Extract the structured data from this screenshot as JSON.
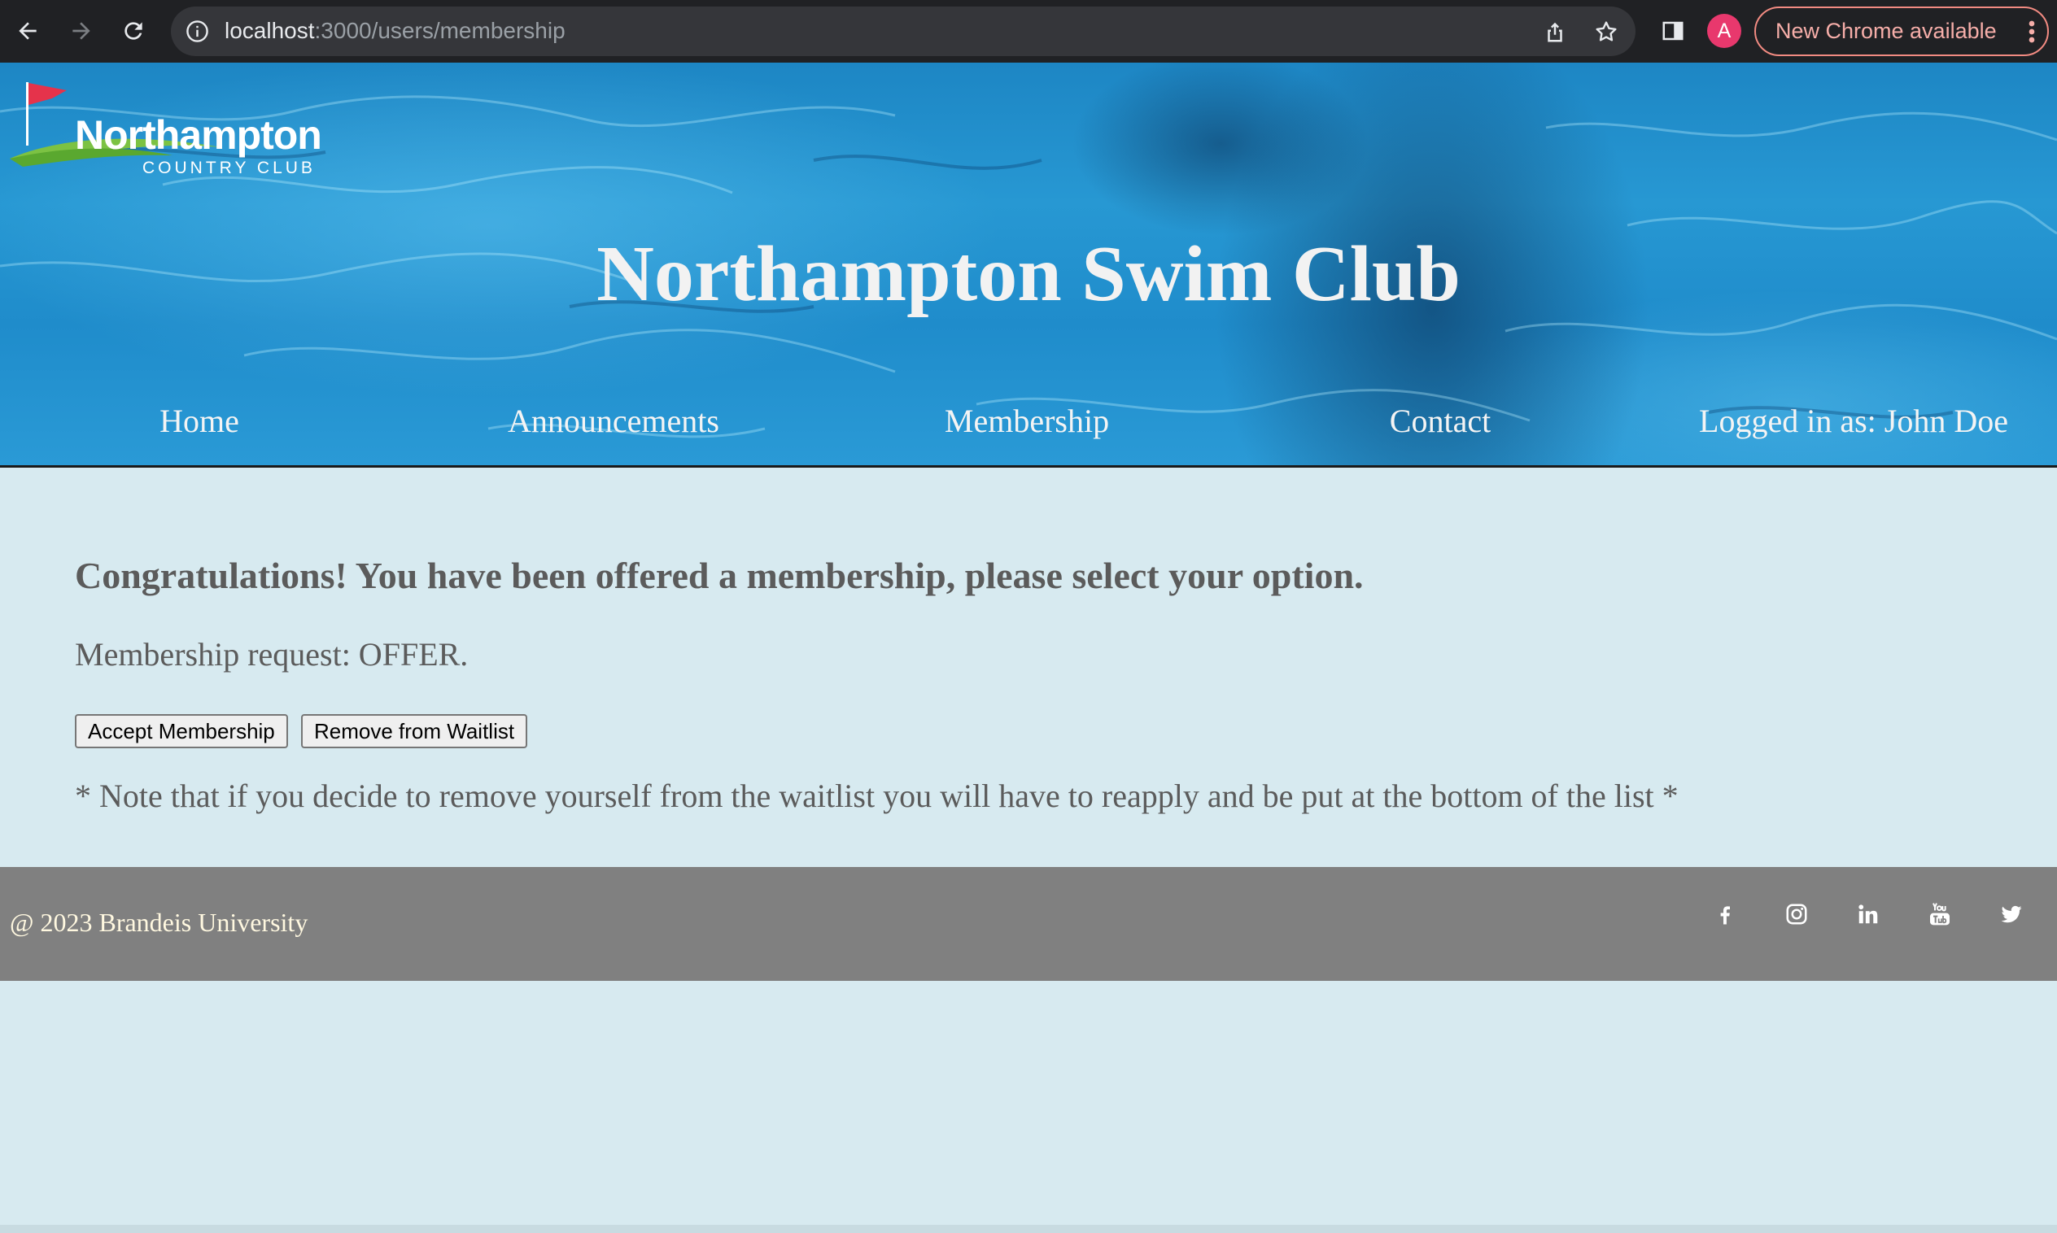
{
  "browser": {
    "url_host": "localhost",
    "url_path": ":3000/users/membership",
    "profile_initial": "A",
    "update_label": "New Chrome available",
    "icons": [
      "back-arrow-icon",
      "forward-arrow-icon",
      "reload-icon",
      "info-icon",
      "share-icon",
      "star-icon",
      "side-panel-icon",
      "more-vert-icon"
    ]
  },
  "header": {
    "logo": {
      "name": "Northampton",
      "subtitle": "COUNTRY CLUB"
    },
    "title": "Northampton Swim Club",
    "nav": [
      {
        "label": "Home"
      },
      {
        "label": "Announcements"
      },
      {
        "label": "Membership"
      },
      {
        "label": "Contact"
      },
      {
        "label": "Logged in as: John Doe"
      }
    ]
  },
  "main": {
    "headline": "Congratulations! You have been offered a membership, please select your option.",
    "status": "Membership request: OFFER.",
    "buttons": {
      "accept": "Accept Membership",
      "remove": "Remove from Waitlist"
    },
    "note": "* Note that if you decide to remove yourself from the waitlist you will have to reapply and be put at the bottom of the list *"
  },
  "footer": {
    "copyright": "@ 2023 Brandeis University",
    "social_icons": [
      "facebook-icon",
      "instagram-icon",
      "linkedin-icon",
      "youtube-icon",
      "twitter-icon"
    ]
  },
  "colors": {
    "page_background": "#d7eaf0",
    "text": "#5b5b5b",
    "footer_background": "#808080",
    "footer_text": "#fff8e0",
    "chrome_background": "#202124",
    "profile": "#e8386d",
    "update_accent": "#f28b82"
  }
}
